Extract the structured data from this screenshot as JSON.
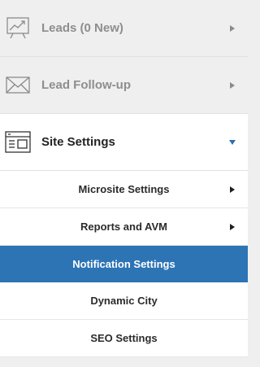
{
  "menu": {
    "leads": {
      "label": "Leads (0 New)",
      "icon": "trend-chart-icon"
    },
    "follow_up": {
      "label": "Lead Follow-up",
      "icon": "envelope-icon"
    },
    "site_settings": {
      "label": "Site Settings",
      "icon": "browser-window-icon",
      "expanded": true,
      "subitems": [
        {
          "label": "Microsite Settings",
          "has_arrow": true
        },
        {
          "label": "Reports and AVM",
          "has_arrow": true
        },
        {
          "label": "Notification Settings",
          "selected": true
        },
        {
          "label": "Dynamic City"
        },
        {
          "label": "SEO Settings"
        }
      ]
    }
  },
  "colors": {
    "selected_bg": "#2d74b5",
    "inactive_text": "#8e8e8e",
    "active_text": "#222222",
    "expand_arrow": "#2c6fb0",
    "background": "#efefef"
  }
}
